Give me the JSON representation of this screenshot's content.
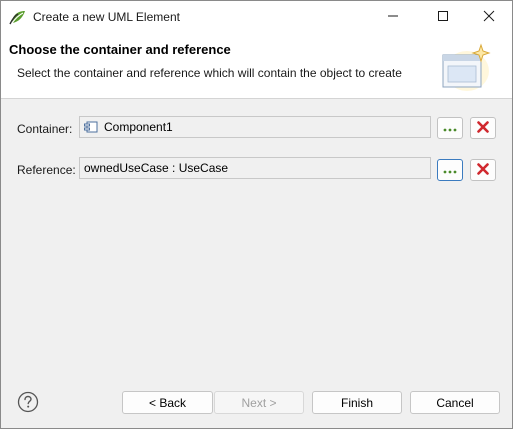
{
  "window": {
    "title": "Create a new UML Element",
    "icons": {
      "app": "papyrus-leaf-icon",
      "minimize": "minimize-icon",
      "maximize": "maximize-icon",
      "close": "close-icon"
    }
  },
  "banner": {
    "title": "Choose the container and reference",
    "description": "Select the container and reference which will contain the object to create",
    "image": "wizard-banner-icon"
  },
  "form": {
    "container": {
      "label": "Container:",
      "value": "Component1",
      "value_icon": "uml-component-icon",
      "browse_icon": "ellipsis-icon",
      "clear_icon": "red-x-icon"
    },
    "reference": {
      "label": "Reference:",
      "value": "ownedUseCase : UseCase",
      "browse_icon": "ellipsis-icon",
      "clear_icon": "red-x-icon"
    }
  },
  "footer": {
    "help_icon": "help-question-icon",
    "back_label": "< Back",
    "next_label": "Next >",
    "finish_label": "Finish",
    "cancel_label": "Cancel"
  },
  "colors": {
    "browse_dots": "#4a8a2a",
    "clear_x": "#d0282e",
    "focus_border": "#3b7bbf"
  }
}
